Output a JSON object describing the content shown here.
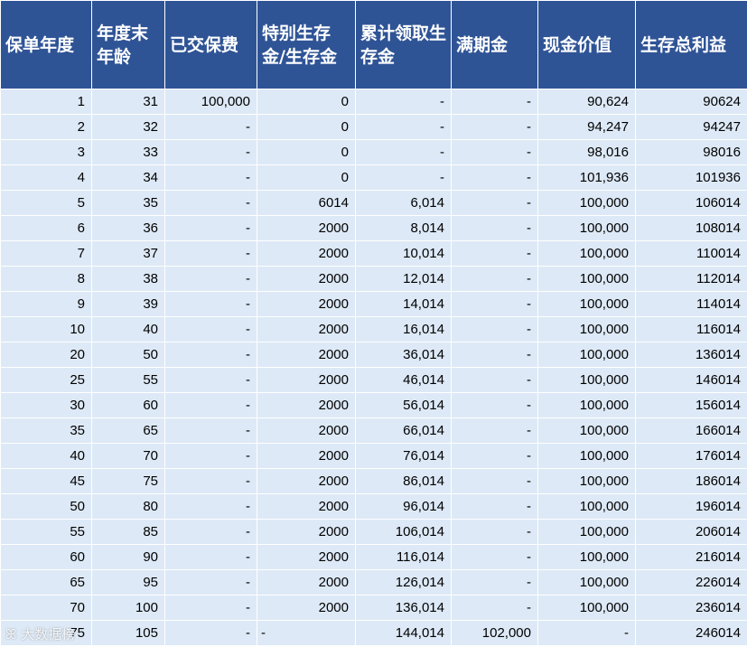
{
  "headers": [
    "保单年度",
    "年度末年龄",
    "已交保费",
    "特别生存金/生存金",
    "累计领取生存金",
    "满期金",
    "现金价值",
    "生存总利益"
  ],
  "rows": [
    [
      "1",
      "31",
      "100,000",
      "0",
      "-",
      "-",
      "90,624",
      "90624"
    ],
    [
      "2",
      "32",
      "-",
      "0",
      "-",
      "-",
      "94,247",
      "94247"
    ],
    [
      "3",
      "33",
      "-",
      "0",
      "-",
      "-",
      "98,016",
      "98016"
    ],
    [
      "4",
      "34",
      "-",
      "0",
      "-",
      "-",
      "101,936",
      "101936"
    ],
    [
      "5",
      "35",
      "-",
      "6014",
      "6,014",
      "-",
      "100,000",
      "106014"
    ],
    [
      "6",
      "36",
      "-",
      "2000",
      "8,014",
      "-",
      "100,000",
      "108014"
    ],
    [
      "7",
      "37",
      "-",
      "2000",
      "10,014",
      "-",
      "100,000",
      "110014"
    ],
    [
      "8",
      "38",
      "-",
      "2000",
      "12,014",
      "-",
      "100,000",
      "112014"
    ],
    [
      "9",
      "39",
      "-",
      "2000",
      "14,014",
      "-",
      "100,000",
      "114014"
    ],
    [
      "10",
      "40",
      "-",
      "2000",
      "16,014",
      "-",
      "100,000",
      "116014"
    ],
    [
      "20",
      "50",
      "-",
      "2000",
      "36,014",
      "-",
      "100,000",
      "136014"
    ],
    [
      "25",
      "55",
      "-",
      "2000",
      "46,014",
      "-",
      "100,000",
      "146014"
    ],
    [
      "30",
      "60",
      "-",
      "2000",
      "56,014",
      "-",
      "100,000",
      "156014"
    ],
    [
      "35",
      "65",
      "-",
      "2000",
      "66,014",
      "-",
      "100,000",
      "166014"
    ],
    [
      "40",
      "70",
      "-",
      "2000",
      "76,014",
      "-",
      "100,000",
      "176014"
    ],
    [
      "45",
      "75",
      "-",
      "2000",
      "86,014",
      "-",
      "100,000",
      "186014"
    ],
    [
      "50",
      "80",
      "-",
      "2000",
      "96,014",
      "-",
      "100,000",
      "196014"
    ],
    [
      "55",
      "85",
      "-",
      "2000",
      "106,014",
      "-",
      "100,000",
      "206014"
    ],
    [
      "60",
      "90",
      "-",
      "2000",
      "116,014",
      "-",
      "100,000",
      "216014"
    ],
    [
      "65",
      "95",
      "-",
      "2000",
      "126,014",
      "-",
      "100,000",
      "226014"
    ],
    [
      "70",
      "100",
      "-",
      "2000",
      "136,014",
      "-",
      "100,000",
      "236014"
    ],
    [
      "75",
      "105",
      "-",
      "-",
      "144,014",
      "102,000",
      "-",
      "246014"
    ]
  ],
  "left_aligned_cells": [
    [
      21,
      3
    ]
  ],
  "watermark": "大数据榜",
  "colors": {
    "header_bg": "#2f5496",
    "header_text": "#ffffff",
    "cell_bg": "#dde9f6",
    "cell_text": "#000000",
    "grid": "#ffffff"
  }
}
